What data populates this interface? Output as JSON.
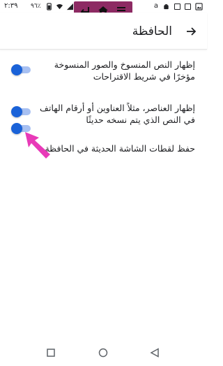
{
  "status_bar": {
    "time": "٢:٣٩",
    "battery_level": "٩٦٪",
    "icons": [
      "cell-signal-icon",
      "wifi-icon",
      "battery-icon",
      "android-icon",
      "amazon-icon",
      "notification-icon",
      "notification-icon",
      "image-icon"
    ]
  },
  "app_bar": {
    "title": "الحافظة",
    "back_icon": "arrow-icon"
  },
  "overlay_nav": {
    "buttons": [
      "back-arrow-icon",
      "home-icon",
      "menu-icon"
    ],
    "color": "#8d2a63"
  },
  "settings": [
    {
      "label": "إظهار النص المنسوخ والصور المنسوخة مؤخرًا في شريط الاقتراحات",
      "enabled": true
    },
    {
      "label": "إظهار العناصر، مثلاً العناوين أو أرقام الهاتف في النص الذي يتم نسخه حديثًا",
      "enabled": true
    },
    {
      "label": "حفظ لقطات الشاشة الحديثة في الحافظة",
      "enabled": true
    }
  ],
  "colors": {
    "accent": "#1a62d8",
    "track": "#a7c0f2",
    "pointer": "#e83ab8"
  },
  "bottom_nav": [
    "square-icon",
    "circle-icon",
    "triangle-icon"
  ]
}
